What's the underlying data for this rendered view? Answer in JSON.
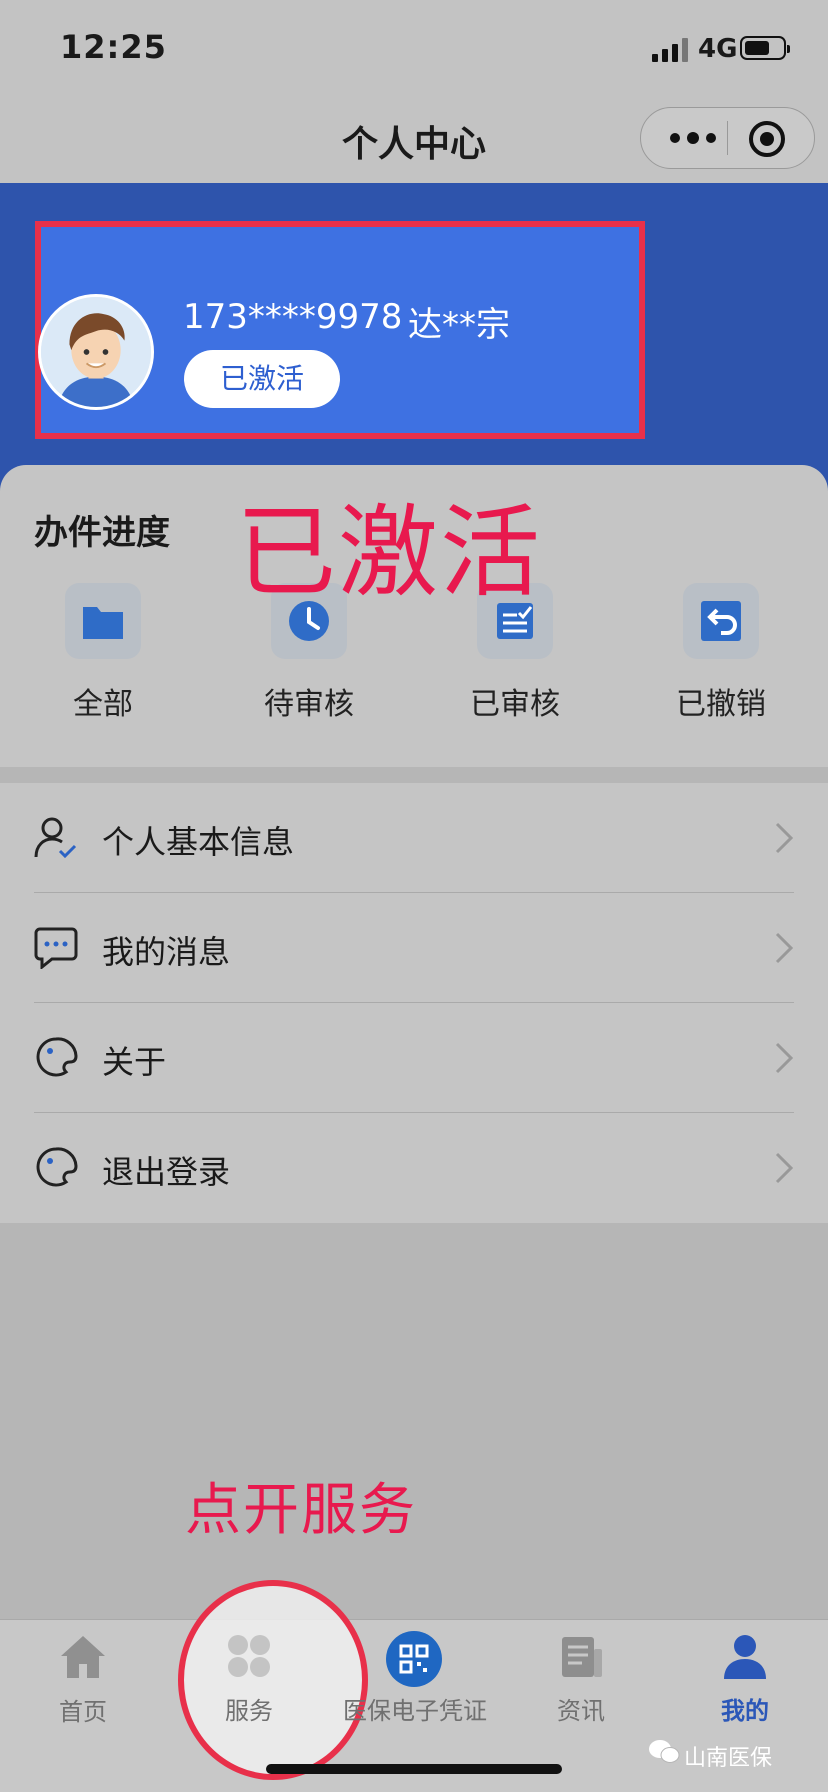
{
  "status_bar": {
    "time": "12:25",
    "network": "4G"
  },
  "nav": {
    "title": "个人中心"
  },
  "profile": {
    "phone": "173****9978",
    "name": "达**宗",
    "status_badge": "已激活"
  },
  "progress": {
    "title": "办件进度",
    "items": [
      {
        "label": "全部",
        "icon": "folder-icon"
      },
      {
        "label": "待审核",
        "icon": "clock-icon"
      },
      {
        "label": "已审核",
        "icon": "checked-document-icon"
      },
      {
        "label": "已撤销",
        "icon": "undo-icon"
      }
    ]
  },
  "menu": {
    "items": [
      {
        "label": "个人基本信息",
        "icon": "user-check-icon"
      },
      {
        "label": "我的消息",
        "icon": "chat-icon"
      },
      {
        "label": "关于",
        "icon": "palette-icon"
      },
      {
        "label": "退出登录",
        "icon": "palette-icon"
      }
    ]
  },
  "annotations": {
    "activated": "已激活",
    "open_service": "点开服务"
  },
  "tab_bar": {
    "items": [
      {
        "label": "首页",
        "icon": "home-icon"
      },
      {
        "label": "服务",
        "icon": "grid-icon"
      },
      {
        "label": "医保电子凭证",
        "icon": "qr-code-icon"
      },
      {
        "label": "资讯",
        "icon": "news-icon"
      },
      {
        "label": "我的",
        "icon": "user-icon"
      }
    ],
    "active": "我的"
  },
  "watermark": "山南医保",
  "colors": {
    "header_blue": "#2e54ac",
    "profile_blue": "#3e71e2",
    "highlight_red": "#e8304a",
    "annotation_pink": "#e8194e",
    "active_tab": "#2b57b8"
  }
}
